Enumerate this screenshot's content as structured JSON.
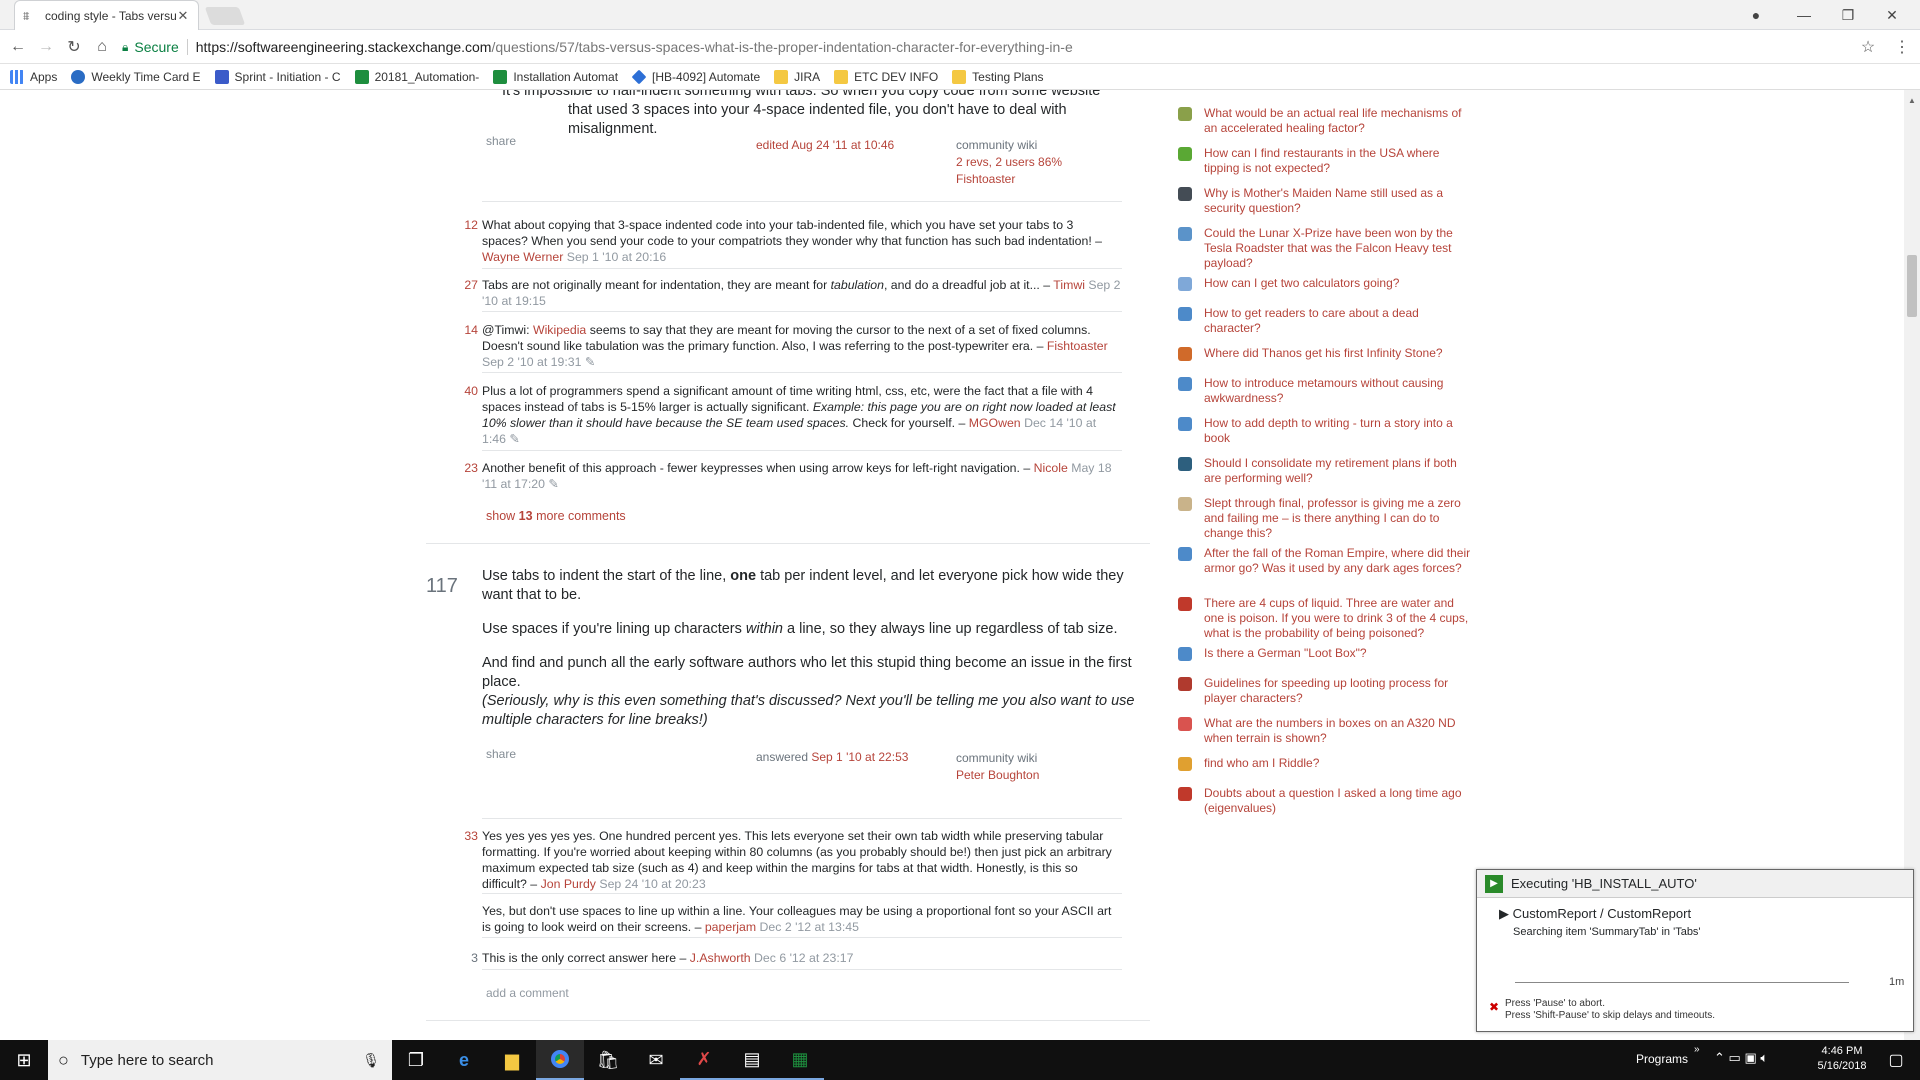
{
  "browser": {
    "tab_title": "coding style - Tabs versus",
    "secure_label": "Secure",
    "url_host": "https://softwareengineering.stackexchange.com",
    "url_path": "/questions/57/tabs-versus-spaces-what-is-the-proper-indentation-character-for-everything-in-e",
    "bookmarks": [
      "Apps",
      "Weekly Time Card E",
      "Sprint - Initiation - C",
      "20181_Automation-",
      "Installation Automat",
      "[HB-4092] Automate",
      "JIRA",
      "ETC DEV INFO",
      "Testing Plans"
    ]
  },
  "answer1": {
    "tail_line1": "It's impossible to half-indent something with tabs. So when you copy code from some website",
    "tail_line2": "that used 3 spaces into your 4-space indented file, you don't have to deal with misalignment.",
    "share": "share",
    "edited": "edited Aug 24 '11 at 10:46",
    "wiki": "community wiki",
    "revs": "2 revs, 2 users 86%",
    "user": "Fishtoaster",
    "comments": [
      {
        "score": "12",
        "text": "What about copying that 3-space indented code into your tab-indented file, which you have set your tabs to 3 spaces? When you send your code to your compatriots they wonder why that function has such bad indentation! –",
        "user": "Wayne Werner",
        "time": "Sep 1 '10 at 20:16"
      },
      {
        "score": "27",
        "text_a": "Tabs are not originally meant for indentation, they are meant for",
        "text_em": "tabulation",
        "text_b": ", and do a dreadful job at it... –",
        "user": "Timwi",
        "time": "Sep 2 '10 at 19:15"
      },
      {
        "score": "14",
        "text_a": "@Timwi:",
        "link": "Wikipedia",
        "text_b": "seems to say that they are meant for moving the cursor to the next of a set of fixed columns. Doesn't sound like tabulation was the primary function. Also, I was referring to the post-typewriter era. –",
        "user": "Fishtoaster",
        "time": "Sep 2 '10 at 19:31"
      },
      {
        "score": "40",
        "text_a": "Plus a lot of programmers spend a significant amount of time writing html, css, etc, were the fact that a file with 4 spaces instead of tabs is 5-15% larger is actually significant.",
        "text_em": "Example: this page you are on right now loaded at least 10% slower than it should have because the SE team used spaces.",
        "text_b": "Check for yourself. –",
        "user": "MGOwen",
        "time": "Dec 14 '10 at 1:46"
      },
      {
        "score": "23",
        "text": "Another benefit of this approach - fewer keypresses when using arrow keys for left-right navigation. –",
        "user": "Nicole",
        "time": "May 18 '11 at 17:20"
      }
    ],
    "show_more_a": "show",
    "show_more_n": "13",
    "show_more_b": "more comments"
  },
  "answer2": {
    "votes": "117",
    "p1_a": "Use tabs to indent the start of the line,",
    "p1_b": "one",
    "p1_c": "tab per indent level, and let everyone pick how wide they want that to be.",
    "p2_a": "Use spaces if you're lining up characters",
    "p2_b": "within",
    "p2_c": "a line, so they always line up regardless of tab size.",
    "p3": "And find and punch all the early software authors who let this stupid thing become an issue in the first place.",
    "p4": "(Seriously, why is this even something that's discussed? Next you'll be telling me you also want to use multiple characters for line breaks!)",
    "share": "share",
    "answered": "answered",
    "answered_time": "Sep 1 '10 at 22:53",
    "wiki": "community wiki",
    "user": "Peter Boughton",
    "comments": [
      {
        "score": "33",
        "text": "Yes yes yes yes yes. One hundred percent yes. This lets everyone set their own tab width while preserving tabular formatting. If you're worried about keeping within 80 columns (as you probably should be!) then just pick an arbitrary maximum expected tab size (such as 4) and keep within the margins for tabs at that width. Honestly, is this so difficult? –",
        "user": "Jon Purdy",
        "time": "Sep 24 '10 at 20:23"
      },
      {
        "score": "",
        "text": "Yes, but don't use spaces to line up within a line. Your colleagues may be using a proportional font so your ASCII art is going to look weird on their screens. –",
        "user": "paperjam",
        "time": "Dec 2 '12 at 13:45"
      },
      {
        "score": "3",
        "text": "This is the only correct answer here –",
        "user": "J.Ashworth",
        "time": "Dec 6 '12 at 23:17"
      }
    ],
    "add_comment": "add a comment"
  },
  "hot_questions": [
    {
      "text": "What would be an actual real life mechanisms of an accelerated healing factor?",
      "color": "#8aa04a"
    },
    {
      "text": "How can I find restaurants in the USA where tipping is not expected?",
      "color": "#5aa834"
    },
    {
      "text": "Why is Mother's Maiden Name still used as a security question?",
      "color": "#444c55"
    },
    {
      "text": "Could the Lunar X-Prize have been won by the Tesla Roadster that was the Falcon Heavy test payload?",
      "color": "#5b93c9"
    },
    {
      "text": "How can I get two calculators going?",
      "color": "#7fa8d8"
    },
    {
      "text": "How to get readers to care about a dead character?",
      "color": "#4d8ac9"
    },
    {
      "text": "Where did Thanos get his first Infinity Stone?",
      "color": "#d06a2a"
    },
    {
      "text": "How to introduce metamours without causing awkwardness?",
      "color": "#4d8ac9"
    },
    {
      "text": "How to add depth to writing - turn a story into a book",
      "color": "#4d8ac9"
    },
    {
      "text": "Should I consolidate my retirement plans if both are performing well?",
      "color": "#2d5f7e"
    },
    {
      "text": "Slept through final, professor is giving me a zero and failing me – is there anything I can do to change this?",
      "color": "#c9b38a"
    },
    {
      "text": "After the fall of the Roman Empire, where did their armor go? Was it used by any dark ages forces?",
      "color": "#4d8ac9"
    },
    {
      "text": "There are 4 cups of liquid. Three are water and one is poison. If you were to drink 3 of the 4 cups, what is the probability of being poisoned?",
      "color": "#c0392b"
    },
    {
      "text": "Is there a German \"Loot Box\"?",
      "color": "#4d8ac9"
    },
    {
      "text": "Guidelines for speeding up looting process for player characters?",
      "color": "#b03a2e"
    },
    {
      "text": "What are the numbers in boxes on an A320 ND when terrain is shown?",
      "color": "#d9534f"
    },
    {
      "text": "find who am I Riddle?",
      "color": "#e0a030"
    },
    {
      "text": "Doubts about a question I asked a long time ago (eigenvalues)",
      "color": "#c0392b"
    }
  ],
  "notification": {
    "title": "Executing 'HB_INSTALL_AUTO'",
    "task": "CustomReport / CustomReport",
    "status": "Searching item 'SummaryTab' in 'Tabs'",
    "timer": "1m",
    "hint1": "Press 'Pause' to abort.",
    "hint2": "Press 'Shift-Pause' to skip delays and timeouts."
  },
  "taskbar": {
    "search_placeholder": "Type here to search",
    "programs": "Programs",
    "time": "4:46 PM",
    "date": "5/16/2018"
  }
}
